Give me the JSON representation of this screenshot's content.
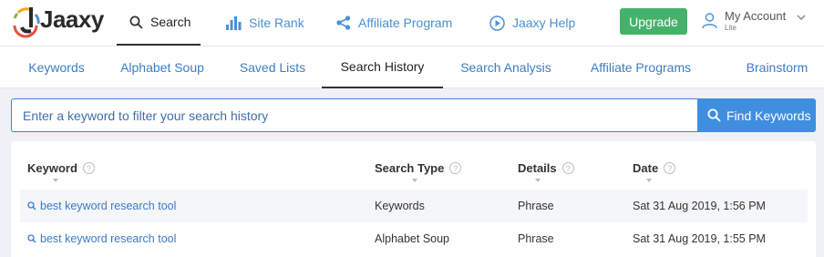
{
  "brand": {
    "name": "Jaaxy"
  },
  "nav": {
    "search": "Search",
    "site_rank": "Site Rank",
    "affiliate_program": "Affiliate Program",
    "jaaxy_help": "Jaaxy Help",
    "upgrade": "Upgrade",
    "account": "My Account",
    "account_tier": "Lite"
  },
  "tabs": [
    "Keywords",
    "Alphabet Soup",
    "Saved Lists",
    "Search History",
    "Search Analysis",
    "Affiliate Programs",
    "Brainstorm"
  ],
  "active_tab": "Search History",
  "search": {
    "placeholder": "Enter a keyword to filter your search history",
    "button": "Find Keywords"
  },
  "table": {
    "columns": [
      "Keyword",
      "Search Type",
      "Details",
      "Date"
    ],
    "rows": [
      {
        "keyword": "best keyword research tool",
        "type": "Keywords",
        "details": "Phrase",
        "date": "Sat 31 Aug 2019, 1:56 PM"
      },
      {
        "keyword": "best keyword research tool",
        "type": "Alphabet Soup",
        "details": "Phrase",
        "date": "Sat 31 Aug 2019, 1:55 PM"
      }
    ]
  },
  "colors": {
    "accent": "#3f8ee0",
    "upgrade": "#45b26b",
    "link": "#3a7bc8"
  }
}
